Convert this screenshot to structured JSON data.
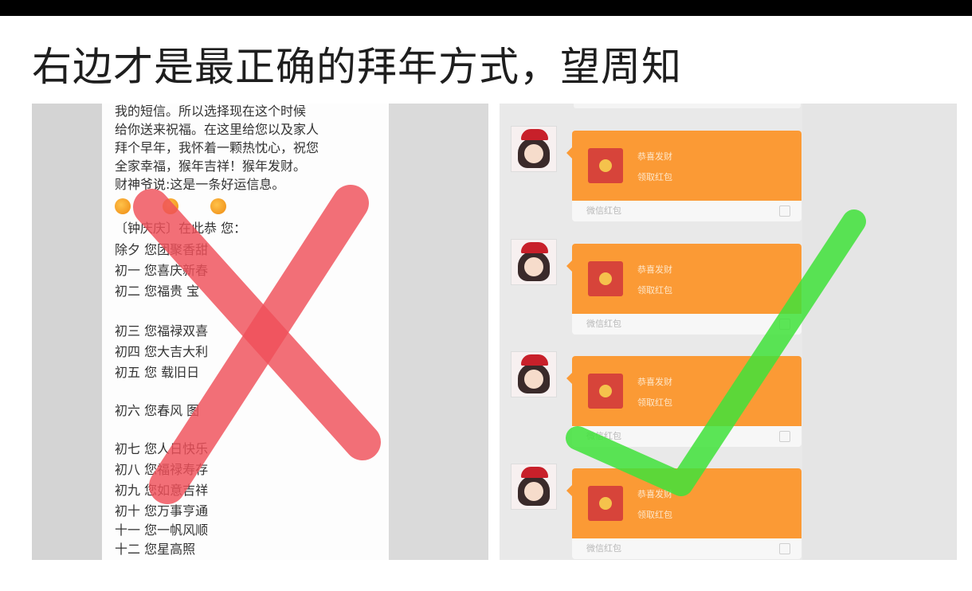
{
  "title": "右边才是最正确的拜年方式，望周知",
  "left_message": {
    "paragraph": "我的短信。所以选择现在这个时候\n给你送来祝福。在这里给您以及家人\n拜个早年，我怀着一颗热忱心，祝您\n全家幸福，猴年吉祥！猴年发财。\n财神爷说:这是一条好运信息。",
    "lines": [
      "〔钟庆庆〕在此恭  您：",
      "除夕        您团聚香甜",
      "初一        您喜庆新春",
      "初二        您福贵       宝",
      "初三        您福禄双喜",
      "初四        您大吉大利",
      "初五        您          载旧日",
      "初六        您春风         图",
      "初七              您人日快乐",
      "初八              您福禄寿存",
      "初九              您如意吉祥",
      "初十              您万事亨通",
      "十一              您一帆风顺",
      "十二              您星高照"
    ]
  },
  "right_message": {
    "bubbles": [
      {
        "line1": "恭喜发财",
        "line2": "领取红包",
        "footer": "微信红包"
      },
      {
        "line1": "恭喜发财",
        "line2": "领取红包",
        "footer": "微信红包"
      },
      {
        "line1": "恭喜发财",
        "line2": "领取红包",
        "footer": "微信红包"
      },
      {
        "line1": "恭喜发财",
        "line2": "领取红包",
        "footer": "微信红包"
      }
    ]
  },
  "colors": {
    "cross": "#f0505a",
    "check": "#3fe23a",
    "red_packet": "#fb9a35",
    "envelope": "#d7443a"
  },
  "icons": [
    "red-cross-mark-icon",
    "green-check-mark-icon",
    "red-envelope-icon",
    "avatar-icon"
  ]
}
